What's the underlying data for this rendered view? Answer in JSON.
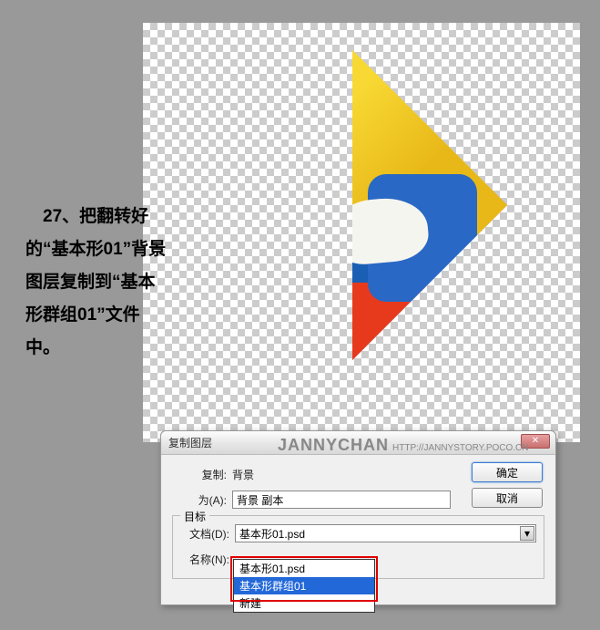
{
  "instruction": "　27、把翻转好的“基本形01”背景图层复制到“基本形群组01”文件中。",
  "dialog": {
    "title": "复制图层",
    "copy_label": "复制:",
    "copy_value": "背景",
    "as_label": "为(A):",
    "as_value": "背景 副本",
    "target_legend": "目标",
    "doc_label": "文档(D):",
    "doc_value": "基本形01.psd",
    "name_label": "名称(N):",
    "ok": "确定",
    "cancel": "取消"
  },
  "dropdown": {
    "items": [
      "基本形01.psd",
      "基本形群组01",
      "新建"
    ],
    "selected_index": 1
  },
  "watermark": {
    "main": "JANNYCHAN",
    "url": "HTTP://JANNYSTORY.POCO.CN"
  },
  "icons": {
    "close": "✕",
    "arrow_down": "▾"
  }
}
